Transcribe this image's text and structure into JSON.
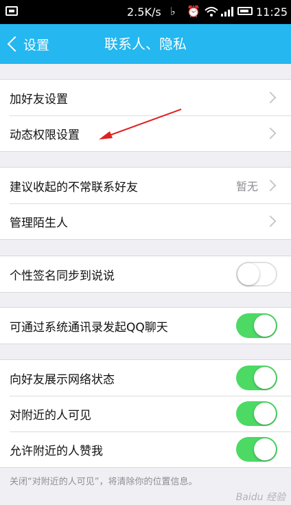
{
  "status_bar": {
    "network_speed": "2.5K/s",
    "time": "11:25",
    "icons": [
      "screen-icon",
      "mute-icon",
      "alarm-icon",
      "wifi-icon",
      "signal-icon",
      "battery-icon"
    ]
  },
  "nav": {
    "back_label": "设置",
    "title": "联系人、隐私"
  },
  "groups": [
    {
      "rows": [
        {
          "label": "加好友设置",
          "type": "link"
        },
        {
          "label": "动态权限设置",
          "type": "link"
        }
      ]
    },
    {
      "rows": [
        {
          "label": "建议收起的不常联系好友",
          "value": "暂无",
          "type": "link"
        },
        {
          "label": "管理陌生人",
          "type": "link"
        }
      ]
    },
    {
      "rows": [
        {
          "label": "个性签名同步到说说",
          "type": "toggle",
          "on": false
        }
      ]
    },
    {
      "rows": [
        {
          "label": "可通过系统通讯录发起QQ聊天",
          "type": "toggle",
          "on": true
        }
      ]
    },
    {
      "rows": [
        {
          "label": "向好友展示网络状态",
          "type": "toggle",
          "on": true
        },
        {
          "label": "对附近的人可见",
          "type": "toggle",
          "on": true
        },
        {
          "label": "允许附近的人赞我",
          "type": "toggle",
          "on": true
        }
      ]
    }
  ],
  "footnote": "关闭“对附近的人可见”，将清除你的位置信息。",
  "watermark": "Baidu 经验",
  "colors": {
    "nav": "#24b7f0",
    "toggle_on": "#4cd964",
    "annotation_arrow": "#e02020"
  }
}
